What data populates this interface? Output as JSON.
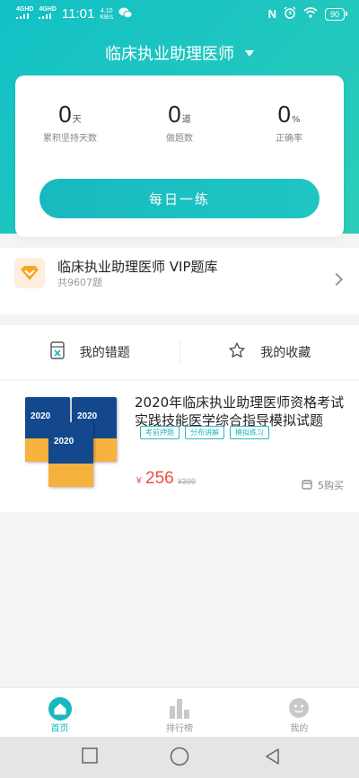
{
  "status_bar": {
    "network_1": "4GHD",
    "network_2": "4GHD",
    "time": "11:01",
    "speed_value": "4.10",
    "speed_unit": "KB/s",
    "battery": "90"
  },
  "header": {
    "title": "临床执业助理医师"
  },
  "stats": [
    {
      "value": "0",
      "unit": "天",
      "label": "累积坚持天数"
    },
    {
      "value": "0",
      "unit": "道",
      "label": "做题数"
    },
    {
      "value": "0",
      "unit": "%",
      "label": "正确率"
    }
  ],
  "practice_button": "每日一练",
  "vip": {
    "title": "临床执业助理医师 VIP题库",
    "subtitle": "共9607题"
  },
  "actions": {
    "mistakes": "我的错题",
    "favorites": "我的收藏"
  },
  "product": {
    "title": "2020年临床执业助理医师资格考试实践技能医学综合指导模拟试题",
    "book_year": "2020",
    "tags": [
      "考前押题",
      "分布讲解",
      "模拟练习"
    ],
    "currency": "¥",
    "price": "256",
    "original_price": "¥399",
    "purchases": "5购买"
  },
  "tabs": [
    {
      "label": "首页",
      "icon": "home-icon",
      "active": true
    },
    {
      "label": "排行榜",
      "icon": "ranking-icon",
      "active": false
    },
    {
      "label": "我的",
      "icon": "profile-icon",
      "active": false
    }
  ],
  "colors": {
    "accent": "#19b8be",
    "price": "#ef4f43",
    "vip": "#f6a623"
  }
}
